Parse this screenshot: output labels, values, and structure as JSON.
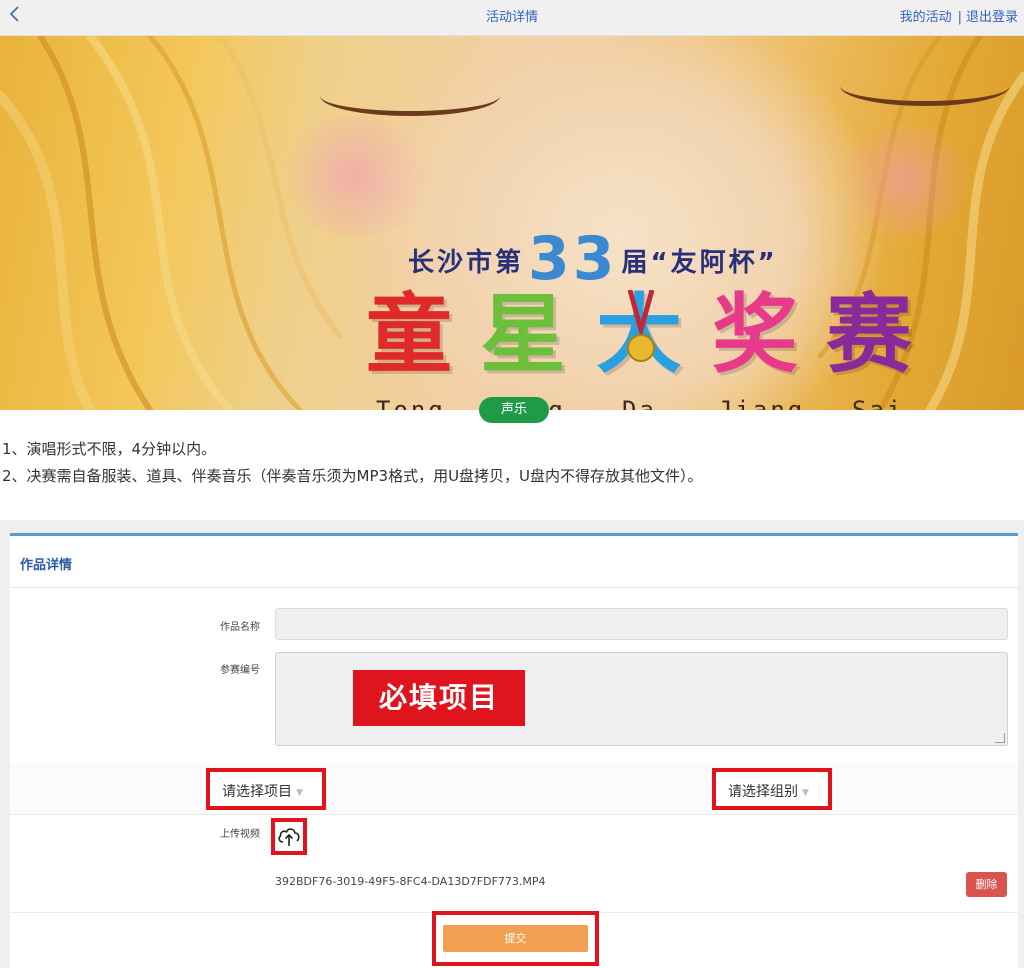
{
  "header": {
    "back_icon": "chevron-left-icon",
    "title": "活动详情",
    "link_my_activities": "我的活动",
    "separator": "|",
    "link_logout": "退出登录",
    "accent_color": "#2f64c2"
  },
  "banner": {
    "subtitle_prefix": "长沙市第",
    "subtitle_number": "33",
    "subtitle_suffix": "届“友阿杯”",
    "title_chars": [
      "童",
      "星",
      "大",
      "奖",
      "赛"
    ],
    "title_colors": [
      "#e02a2a",
      "#6cbf3a",
      "#2aa0e0",
      "#e83a8a",
      "#8a2a9a"
    ],
    "pinyin": [
      "Tong",
      "Xing",
      "Da",
      "Jiang",
      "Sai"
    ],
    "category_badge": "声乐",
    "badge_color": "#1f9a47"
  },
  "rules": [
    "1、演唱形式不限，4分钟以内。",
    "2、决赛需自备服装、道具、伴奏音乐（伴奏音乐须为MP3格式，用U盘拷贝，U盘内不得存放其他文件）。"
  ],
  "form": {
    "section_title": "作品详情",
    "work_name_label": "作品名称",
    "work_name_value": "",
    "entry_id_label": "参赛编号",
    "entry_id_value": "",
    "required_annotation": "必填项目",
    "select_project": "请选择项目",
    "select_group": "请选择组别",
    "upload_label": "上传视频",
    "upload_icon": "cloud-upload-icon",
    "uploaded_file": "392BDF76-3019-49F5-8FC4-DA13D7FDF773.MP4",
    "delete_label": "删除",
    "submit_label": "提交",
    "highlight_color": "#e0141c",
    "submit_color": "#f0a050",
    "delete_color": "#d9534f"
  }
}
